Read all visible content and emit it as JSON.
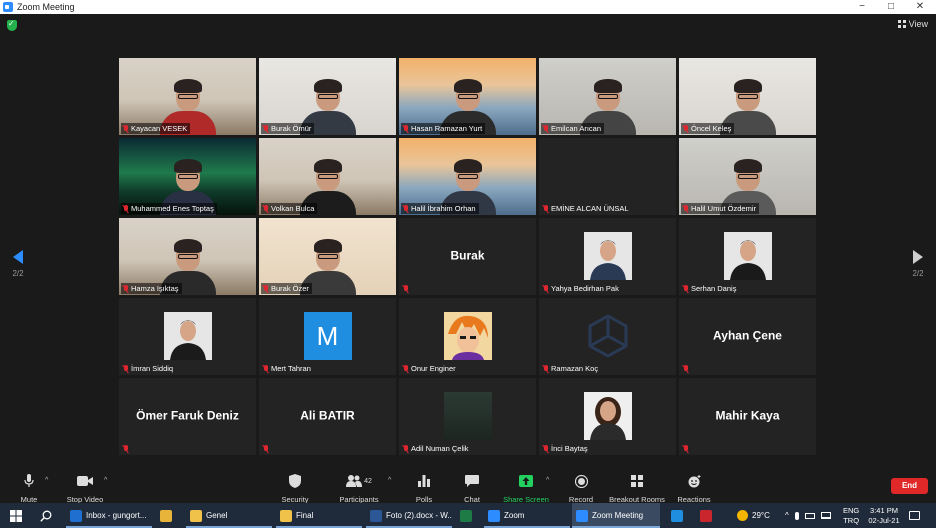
{
  "window": {
    "title": "Zoom Meeting"
  },
  "window_controls": {
    "minimize": "−",
    "maximize": "□",
    "close": "✕"
  },
  "view_button": {
    "label": "View"
  },
  "pager": {
    "left": "2/2",
    "right": "2/2"
  },
  "participants": [
    {
      "name": "Kayacan VESEK",
      "kind": "video",
      "scene": "room",
      "shirt": "#b02a2a"
    },
    {
      "name": "Burak Ömür",
      "kind": "video",
      "scene": "white",
      "shirt": "#333a44"
    },
    {
      "name": "Hasan Ramazan Yurt",
      "kind": "video",
      "scene": "bridge",
      "shirt": "#2b2b2b"
    },
    {
      "name": "Emilcan Arıcan",
      "kind": "video",
      "scene": "light",
      "shirt": "#444444"
    },
    {
      "name": "Öncel Keleş",
      "kind": "video",
      "scene": "white",
      "shirt": "#4a4a4a"
    },
    {
      "name": "Muhammed Enes Toptaş",
      "kind": "video",
      "scene": "aurora",
      "shirt": "#2a3044"
    },
    {
      "name": "Volkan Bulca",
      "kind": "video",
      "scene": "room",
      "shirt": "#1c1c1c"
    },
    {
      "name": "Halil İbrahim Orhan",
      "kind": "video",
      "scene": "bridge",
      "shirt": "#303846"
    },
    {
      "name": "EMİNE ALCAN ÜNSAL",
      "kind": "blank"
    },
    {
      "name": "Halil Umut Özdemir",
      "kind": "video",
      "scene": "light",
      "shirt": "#5a5a5a"
    },
    {
      "name": "Hamza Işıktaş",
      "kind": "video",
      "scene": "room",
      "shirt": "#2a2a2a"
    },
    {
      "name": "Burak Özer",
      "kind": "video",
      "scene": "beige",
      "shirt": "#3a3a3a"
    },
    {
      "name": "",
      "kind": "text",
      "bigname": "Burak"
    },
    {
      "name": "Yahya Bedirhan Pak",
      "kind": "photo",
      "shirt": "#2a3a55"
    },
    {
      "name": "Serhan Daniş",
      "kind": "photo",
      "shirt": "#1a1a1a"
    },
    {
      "name": "İmran Siddiq",
      "kind": "photo",
      "shirt": "#1b1b1b"
    },
    {
      "name": "Mert Tahran",
      "kind": "initial",
      "initial": "M"
    },
    {
      "name": "Onur Enginer",
      "kind": "anime"
    },
    {
      "name": "Ramazan Koç",
      "kind": "unity"
    },
    {
      "name": "",
      "kind": "text",
      "bigname": "Ayhan Çene"
    },
    {
      "name": "",
      "kind": "text",
      "bigname": "Ömer Faruk Deniz"
    },
    {
      "name": "",
      "kind": "text",
      "bigname": "Ali BATIR"
    },
    {
      "name": "Adil Numan Çelik",
      "kind": "dark"
    },
    {
      "name": "İnci Baytaş",
      "kind": "photo-woman"
    },
    {
      "name": "",
      "kind": "text",
      "bigname": "Mahir Kaya"
    }
  ],
  "toolbar": {
    "mute": "Mute",
    "stop_video": "Stop Video",
    "security": "Security",
    "participants": "Participants",
    "participants_count": "42",
    "polls": "Polls",
    "chat": "Chat",
    "share_screen": "Share Screen",
    "record": "Record",
    "breakout_rooms": "Breakout Rooms",
    "reactions": "Reactions",
    "end": "End"
  },
  "taskbar": {
    "items": [
      {
        "label": "Inbox - gungort...",
        "icon_color": "#1f6fd0",
        "state": "open"
      },
      {
        "label": "",
        "icon_color": "#e8b53a",
        "state": "plain"
      },
      {
        "label": "Genel",
        "icon_color": "#f0c24a",
        "state": "open"
      },
      {
        "label": "Final",
        "icon_color": "#f0c24a",
        "state": "open"
      },
      {
        "label": "Foto (2).docx - W...",
        "icon_color": "#2b5797",
        "state": "open"
      },
      {
        "label": "",
        "icon_color": "#1e7b45",
        "state": "plain"
      },
      {
        "label": "Zoom",
        "icon_color": "#2d8cff",
        "state": "open"
      },
      {
        "label": "Zoom Meeting",
        "icon_color": "#2d8cff",
        "state": "active"
      },
      {
        "label": "",
        "icon_color": "#1f8de0",
        "state": "plain"
      },
      {
        "label": "",
        "icon_color": "#c9272d",
        "state": "plain"
      }
    ],
    "weather": "29°C",
    "lang_top": "ENG",
    "lang_bottom": "TRQ",
    "time": "3:41 PM",
    "date": "02-Jul-21"
  }
}
